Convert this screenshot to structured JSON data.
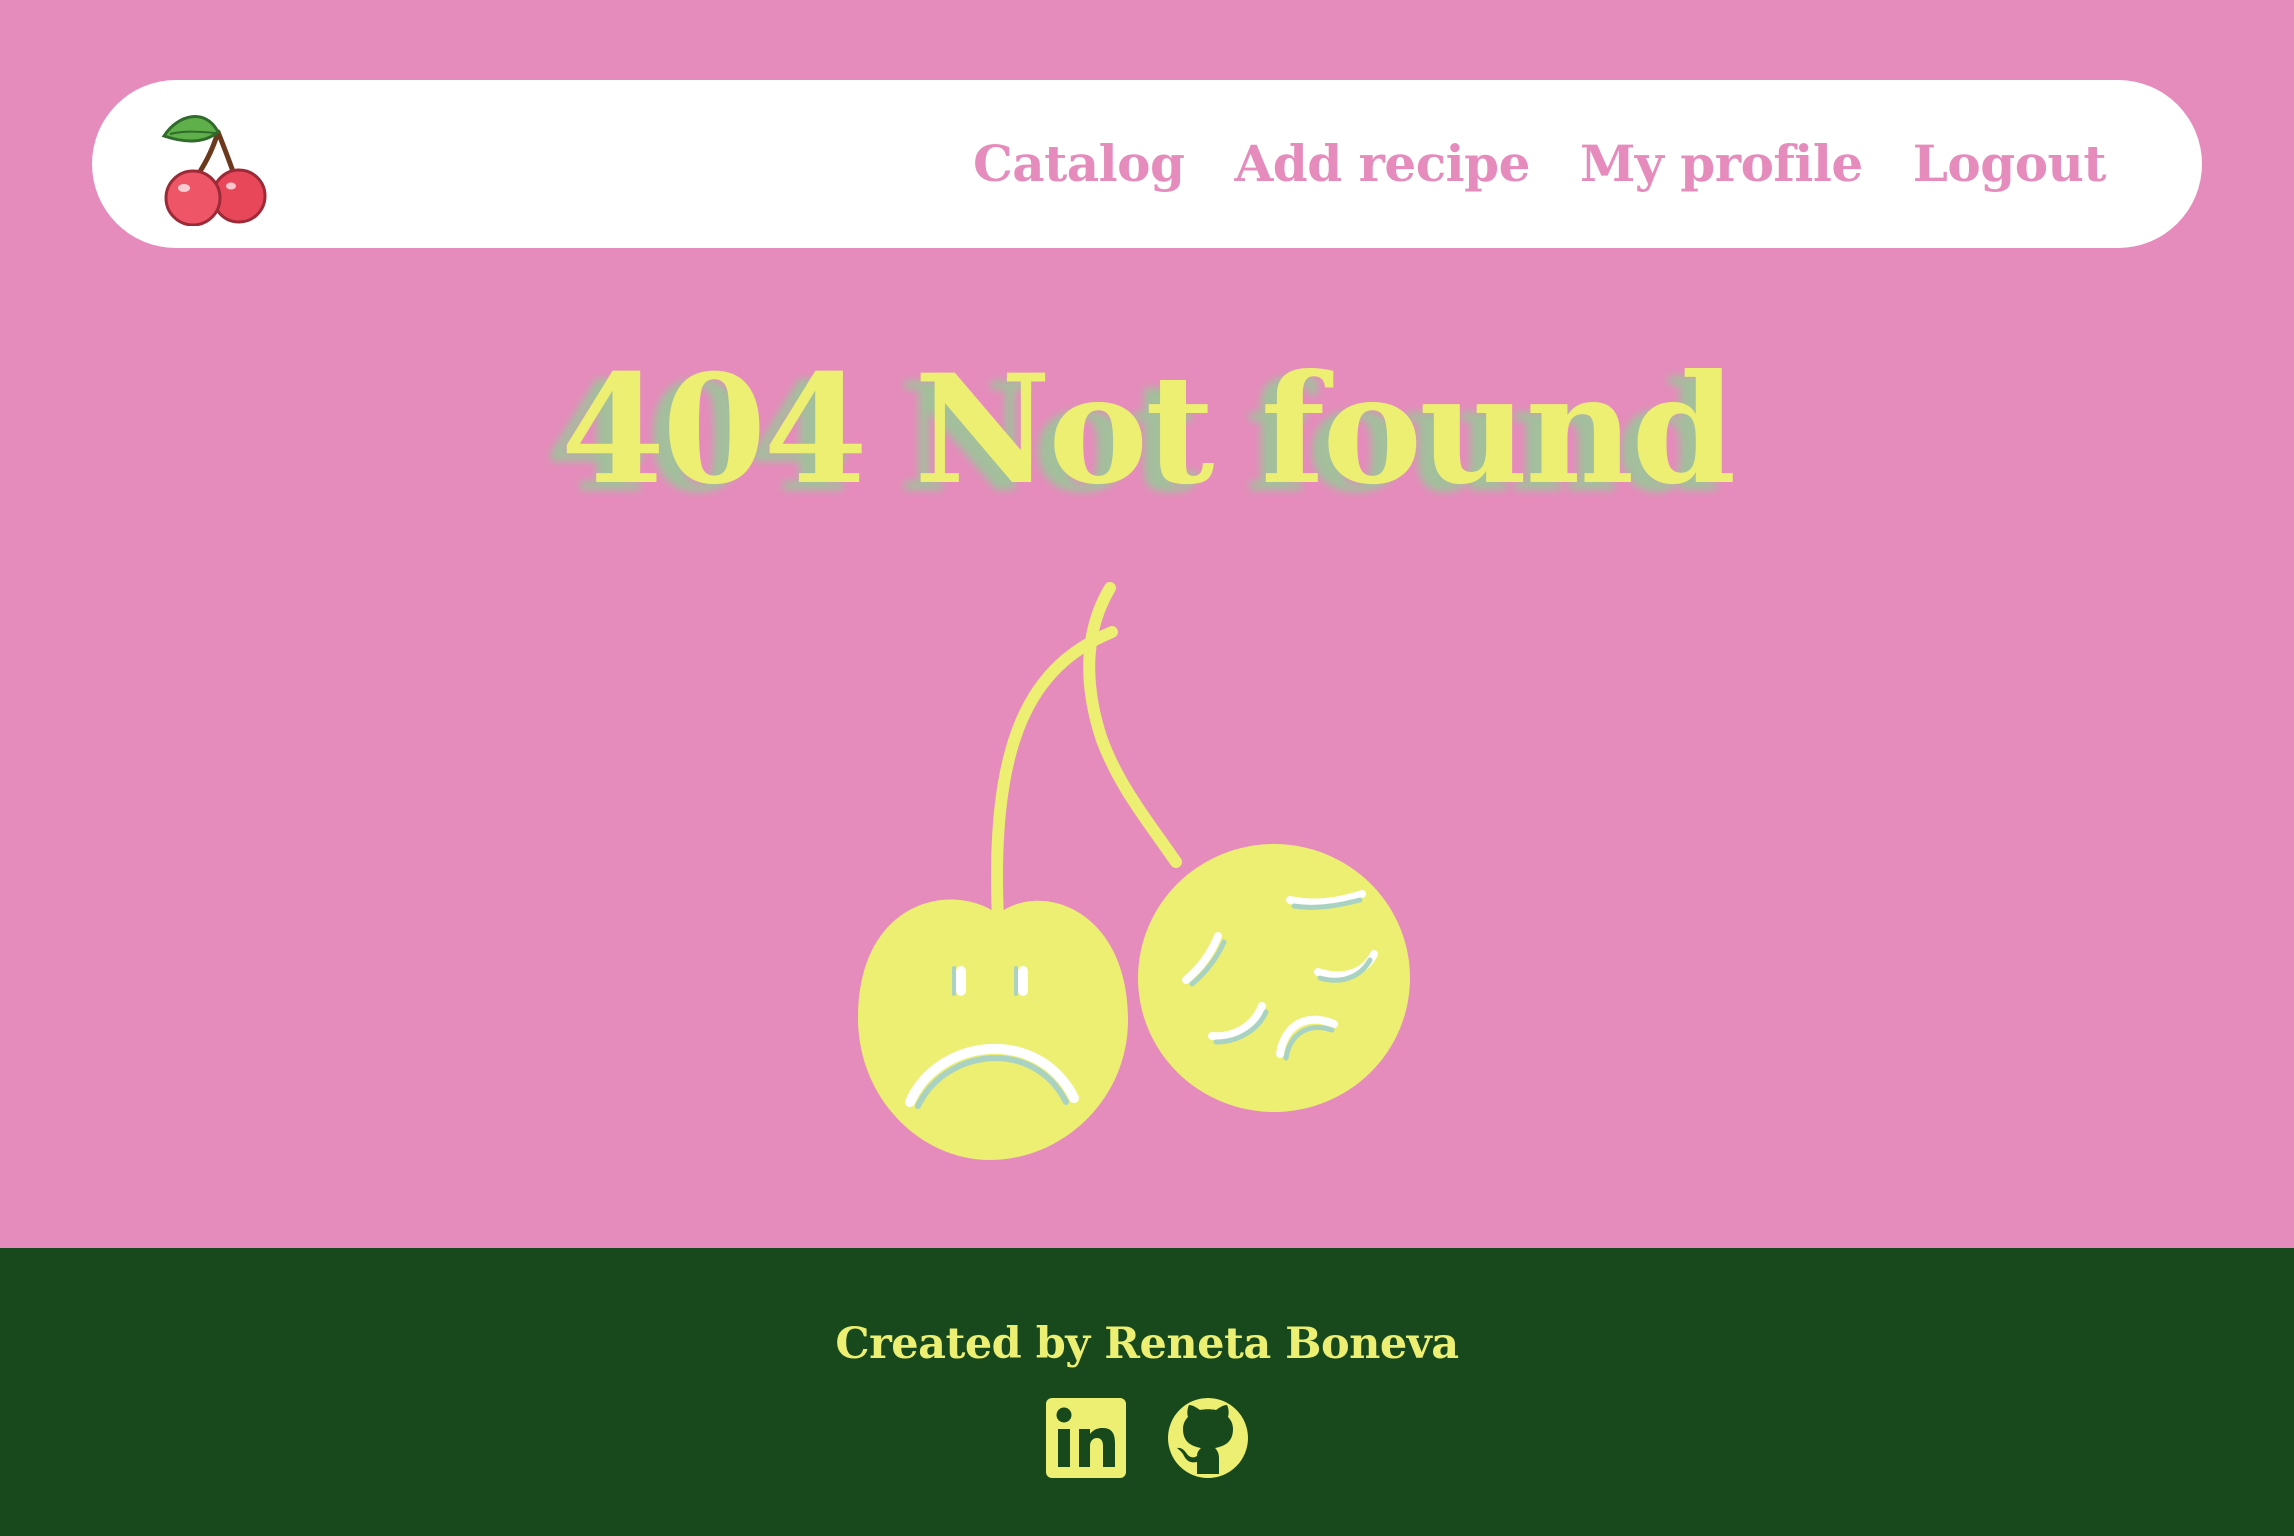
{
  "header": {
    "logo_icon": "cherry-logo-icon",
    "nav": [
      {
        "label": "Catalog"
      },
      {
        "label": "Add recipe"
      },
      {
        "label": "My profile"
      },
      {
        "label": "Logout"
      }
    ]
  },
  "main": {
    "title": "404 Not found",
    "illustration_icon": "sad-cherries-icon"
  },
  "footer": {
    "credit": "Created by Reneta Boneva",
    "socials": [
      {
        "icon": "linkedin-icon"
      },
      {
        "icon": "github-icon"
      }
    ]
  },
  "colors": {
    "background": "#e68cbc",
    "header_bg": "#ffffff",
    "nav_text": "#e68cbc",
    "accent_yellow": "#ecef72",
    "footer_bg": "#17491c"
  }
}
